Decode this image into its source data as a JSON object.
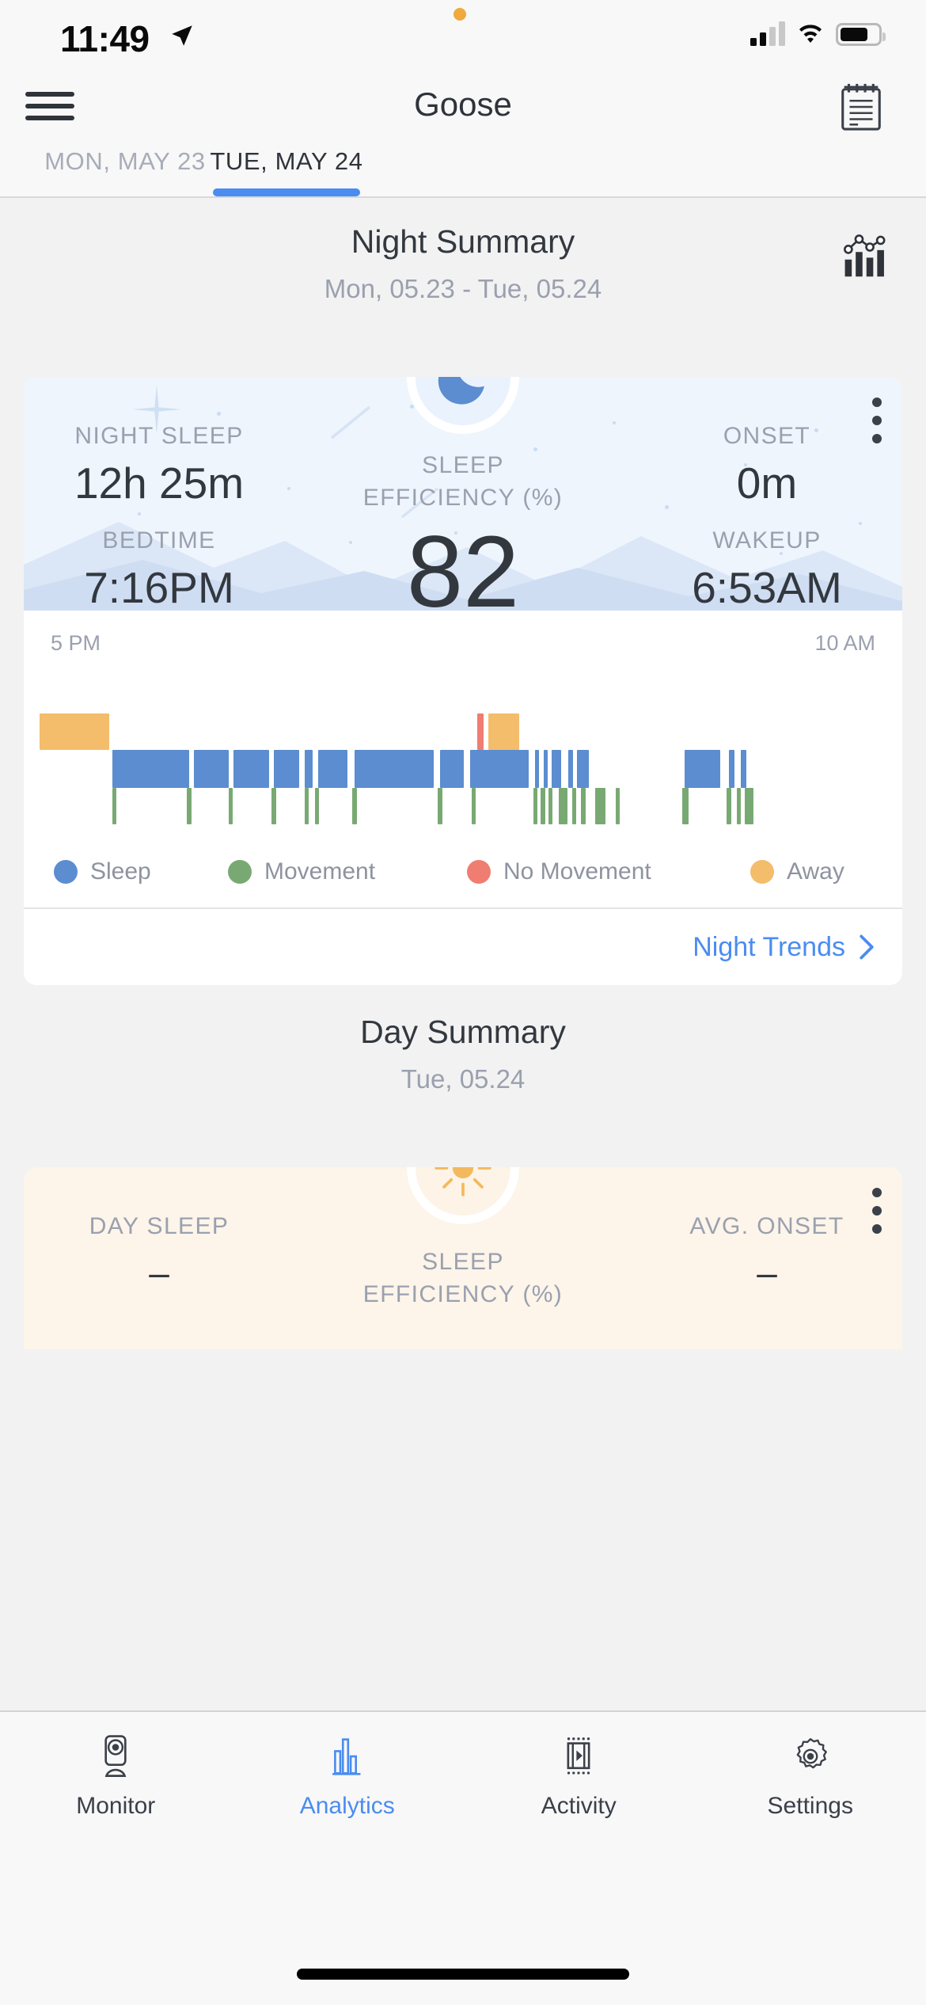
{
  "status_bar": {
    "time": "11:49",
    "location_icon": "location-arrow-icon",
    "recording_dot": "orange-recording-dot",
    "cellular_icon": "cellular-signal-icon",
    "wifi_icon": "wifi-icon",
    "battery_icon": "battery-icon"
  },
  "nav": {
    "menu_icon": "hamburger-menu-icon",
    "title": "Goose",
    "notes_icon": "notepad-icon"
  },
  "day_tabs": {
    "items": [
      {
        "label": "MON, MAY 23",
        "active": false
      },
      {
        "label": "TUE, MAY 24",
        "active": true
      }
    ],
    "active_color": "#4a8cf0"
  },
  "night_summary": {
    "title": "Night Summary",
    "subtitle": "Mon, 05.23 - Tue, 05.24",
    "trends_icon": "analytics-chart-icon",
    "badge_icon": "moon-icon",
    "menu_icon": "kebab-menu-icon",
    "stats": {
      "night_sleep_label": "NIGHT SLEEP",
      "night_sleep_value": "12h 25m",
      "onset_label": "ONSET",
      "onset_value": "0m",
      "bedtime_label": "BEDTIME",
      "bedtime_value": "7:16PM",
      "wakeup_label": "WAKEUP",
      "wakeup_value": "6:53AM",
      "efficiency_label": "SLEEP\nEFFICIENCY (%)",
      "efficiency_label_line1": "SLEEP",
      "efficiency_label_line2": "EFFICIENCY (%)",
      "efficiency_value": "82"
    },
    "timeline": {
      "start_label": "5 PM",
      "end_label": "10 AM"
    },
    "legend": [
      {
        "label": "Sleep",
        "color": "#5b8dd0"
      },
      {
        "label": "Movement",
        "color": "#79a973"
      },
      {
        "label": "No Movement",
        "color": "#ef7d72"
      },
      {
        "label": "Away",
        "color": "#f3bd6b"
      }
    ],
    "trends_link": "Night Trends",
    "trends_chevron": "chevron-right-icon"
  },
  "day_summary": {
    "title": "Day Summary",
    "subtitle": "Tue, 05.24",
    "badge_icon": "sun-icon",
    "menu_icon": "kebab-menu-icon",
    "stats": {
      "day_sleep_label": "DAY SLEEP",
      "day_sleep_value": "–",
      "avg_onset_label": "AVG. ONSET",
      "avg_onset_value": "–",
      "efficiency_label_line1": "SLEEP",
      "efficiency_label_line2": "EFFICIENCY (%)"
    }
  },
  "tab_bar": {
    "items": [
      {
        "label": "Monitor",
        "icon": "camera-monitor-icon",
        "active": false
      },
      {
        "label": "Analytics",
        "icon": "bar-chart-icon",
        "active": true
      },
      {
        "label": "Activity",
        "icon": "film-play-icon",
        "active": false
      },
      {
        "label": "Settings",
        "icon": "gear-icon",
        "active": false
      }
    ],
    "active_color": "#4a8cf0"
  },
  "chart_data": {
    "type": "bar",
    "title": "Night sleep timeline",
    "xlabel": "",
    "ylabel": "",
    "x_axis_start": "5 PM",
    "x_axis_end": "10 AM",
    "grid": false,
    "legend_position": "bottom",
    "categories": [
      "Sleep",
      "Movement",
      "No Movement",
      "Away"
    ],
    "colors": {
      "sleep": "#5b8dd0",
      "movement": "#79a973",
      "no_movement": "#ef7d72",
      "away": "#f3bd6b"
    },
    "series": [
      {
        "name": "Away",
        "color": "#f3bd6b",
        "row": 0,
        "segments": [
          {
            "start_pct": 0.0,
            "width_pct": 8.2
          },
          {
            "start_pct": 53.0,
            "width_pct": 3.6
          }
        ]
      },
      {
        "name": "No Movement",
        "color": "#ef7d72",
        "row": 0,
        "segments": [
          {
            "start_pct": 51.7,
            "width_pct": 0.75
          }
        ]
      },
      {
        "name": "Sleep",
        "color": "#5b8dd0",
        "row": 1,
        "segments": [
          {
            "start_pct": 8.6,
            "width_pct": 9.1
          },
          {
            "start_pct": 18.2,
            "width_pct": 4.1
          },
          {
            "start_pct": 22.9,
            "width_pct": 4.2
          },
          {
            "start_pct": 27.7,
            "width_pct": 3.0
          },
          {
            "start_pct": 31.3,
            "width_pct": 0.9
          },
          {
            "start_pct": 32.9,
            "width_pct": 3.5
          },
          {
            "start_pct": 37.2,
            "width_pct": 9.3
          },
          {
            "start_pct": 47.3,
            "width_pct": 2.8
          },
          {
            "start_pct": 50.8,
            "width_pct": 7.0
          },
          {
            "start_pct": 58.5,
            "width_pct": 0.5
          },
          {
            "start_pct": 59.5,
            "width_pct": 0.5
          },
          {
            "start_pct": 60.5,
            "width_pct": 1.1
          },
          {
            "start_pct": 62.4,
            "width_pct": 0.6
          },
          {
            "start_pct": 63.5,
            "width_pct": 1.4
          },
          {
            "start_pct": 76.2,
            "width_pct": 4.2
          },
          {
            "start_pct": 81.4,
            "width_pct": 0.7
          },
          {
            "start_pct": 82.8,
            "width_pct": 0.7
          }
        ]
      },
      {
        "name": "Movement",
        "color": "#79a973",
        "row": 2,
        "segments": [
          {
            "start_pct": 8.6,
            "width_pct": 0.5
          },
          {
            "start_pct": 17.4,
            "width_pct": 0.5
          },
          {
            "start_pct": 22.3,
            "width_pct": 0.5
          },
          {
            "start_pct": 27.4,
            "width_pct": 0.5
          },
          {
            "start_pct": 31.3,
            "width_pct": 0.5
          },
          {
            "start_pct": 32.5,
            "width_pct": 0.5
          },
          {
            "start_pct": 36.9,
            "width_pct": 0.6
          },
          {
            "start_pct": 47.0,
            "width_pct": 0.6
          },
          {
            "start_pct": 51.0,
            "width_pct": 0.5
          },
          {
            "start_pct": 58.3,
            "width_pct": 0.5
          },
          {
            "start_pct": 59.2,
            "width_pct": 0.5
          },
          {
            "start_pct": 60.1,
            "width_pct": 0.5
          },
          {
            "start_pct": 61.3,
            "width_pct": 1.0
          },
          {
            "start_pct": 62.9,
            "width_pct": 0.5
          },
          {
            "start_pct": 63.9,
            "width_pct": 0.6
          },
          {
            "start_pct": 65.6,
            "width_pct": 1.2
          },
          {
            "start_pct": 68.0,
            "width_pct": 0.5
          },
          {
            "start_pct": 75.9,
            "width_pct": 0.7
          },
          {
            "start_pct": 81.1,
            "width_pct": 0.6
          },
          {
            "start_pct": 82.3,
            "width_pct": 0.5
          },
          {
            "start_pct": 83.3,
            "width_pct": 1.0
          }
        ]
      }
    ]
  }
}
